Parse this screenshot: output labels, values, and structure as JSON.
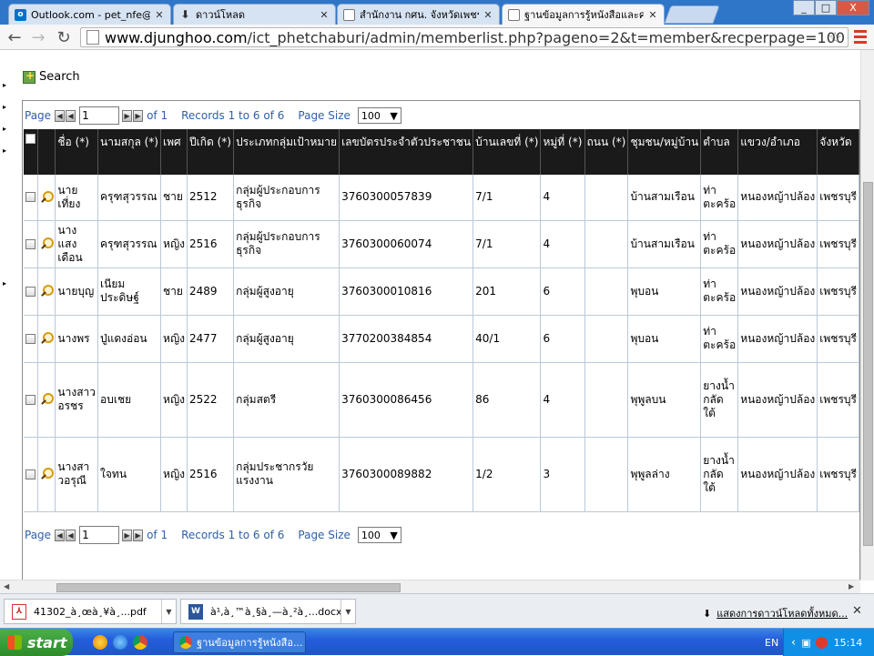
{
  "browser": {
    "tabs": [
      {
        "label": "Outlook.com - pet_nfe@hotn",
        "icon": "outlook-icon"
      },
      {
        "label": "ดาวน์โหลด",
        "icon": "download-icon"
      },
      {
        "label": "สำนักงาน กศน. จังหวัดเพชรบุ",
        "icon": "page-icon"
      },
      {
        "label": "ฐานข้อมูลการรู้หนังสือและคว",
        "icon": "page-icon"
      }
    ],
    "url_host": "www.djunghoo.com",
    "url_path": "/ict_phetchaburi/admin/memberlist.php?pageno=2&t=member&recperpage=100",
    "window_buttons": [
      "_",
      "□",
      "X"
    ]
  },
  "page": {
    "search_label": "Search",
    "pager": {
      "page_label": "Page",
      "page_value": "1",
      "of_label": "of 1",
      "records_label": "Records 1 to 6 of 6",
      "page_size_label": "Page Size",
      "page_size_value": "100"
    },
    "table": {
      "columns": [
        "",
        "",
        "ชื่อ (*)",
        "นามสกุล (*)",
        "เพศ",
        "ปีเกิด (*)",
        "ประเภทกลุ่มเป้าหมาย",
        "เลขบัตรประจำตัวประชาชน",
        "บ้านเลขที่ (*)",
        "หมู่ที่ (*)",
        "ถนน (*)",
        "ชุมชน/หมู่บ้าน",
        "ตำบล",
        "แขวง/อำเภอ",
        "จังหวัด"
      ],
      "rows": [
        {
          "first": "นายเที่ยง",
          "last": "ครุฑสุวรรณ",
          "sex": "ชาย",
          "year": "2512",
          "group": "กลุ่มผู้ประกอบการธุรกิจ",
          "id": "3760300057839",
          "house": "7/1",
          "moo": "4",
          "road": "",
          "village": "บ้านสามเรือน",
          "tambon": "ท่าตะคร้อ",
          "amphoe": "หนองหญ้าปล้อง",
          "province": "เพชรบุรี"
        },
        {
          "first": "นางแสงเดือน",
          "last": "ครุฑสุวรรณ",
          "sex": "หญิง",
          "year": "2516",
          "group": "กลุ่มผู้ประกอบการธุรกิจ",
          "id": "3760300060074",
          "house": "7/1",
          "moo": "4",
          "road": "",
          "village": "บ้านสามเรือน",
          "tambon": "ท่าตะคร้อ",
          "amphoe": "หนองหญ้าปล้อง",
          "province": "เพชรบุรี"
        },
        {
          "first": "นายบุญ",
          "last": "เนียมประดิษฐ์",
          "sex": "ชาย",
          "year": "2489",
          "group": "กลุ่มผู้สูงอายุ",
          "id": "3760300010816",
          "house": "201",
          "moo": "6",
          "road": "",
          "village": "พุบอน",
          "tambon": "ท่าตะคร้อ",
          "amphoe": "หนองหญ้าปล้อง",
          "province": "เพชรบุรี"
        },
        {
          "first": "นางพร",
          "last": "ปู่แดงอ่อน",
          "sex": "หญิง",
          "year": "2477",
          "group": "กลุ่มผู้สูงอายุ",
          "id": "3770200384854",
          "house": "40/1",
          "moo": "6",
          "road": "",
          "village": "พุบอน",
          "tambon": "ท่าตะคร้อ",
          "amphoe": "หนองหญ้าปล้อง",
          "province": "เพชรบุรี"
        },
        {
          "first": "นางสาวอรชร",
          "last": "อบเชย",
          "sex": "หญิง",
          "year": "2522",
          "group": "กลุ่มสตรี",
          "id": "3760300086456",
          "house": "86",
          "moo": "4",
          "road": "",
          "village": "พุพูลบน",
          "tambon": "ยางน้ำกลัดใต้",
          "amphoe": "หนองหญ้าปล้อง",
          "province": "เพชรบุรี"
        },
        {
          "first": "นางสาวอรุณี",
          "last": "ใจทน",
          "sex": "หญิง",
          "year": "2516",
          "group": "กลุ่มประชากรวัยแรงงาน",
          "id": "3760300089882",
          "house": "1/2",
          "moo": "3",
          "road": "",
          "village": "พุพูลล่าง",
          "tambon": "ยางน้ำกลัดใต้",
          "amphoe": "หนองหญ้าปล้อง",
          "province": "เพชรบุรี"
        }
      ]
    }
  },
  "downloads": {
    "items": [
      {
        "label": "41302_à¸œà¸¥à¸...pdf",
        "icon": "pdf-icon"
      },
      {
        "label": "à¹‚à¸™à¸§à¸—à¸²à¸...docx",
        "icon": "word-icon"
      }
    ],
    "show_all": "แสดงการดาวน์โหลดทั้งหมด..."
  },
  "taskbar": {
    "start_label": "start",
    "task_label": "ฐานข้อมูลการรู้หนังสือ...",
    "lang": "EN",
    "time": "15:14"
  },
  "colors": {
    "header_bg": "#1a1a1a",
    "link_blue": "#2f5fa8",
    "taskbar_blue": "#245edb"
  }
}
